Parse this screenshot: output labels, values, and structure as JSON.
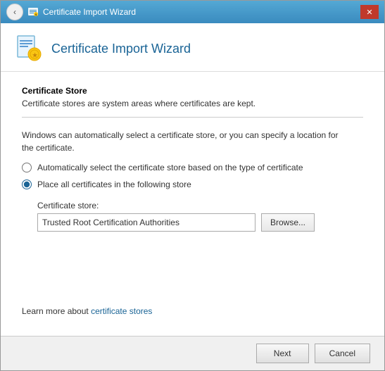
{
  "window": {
    "title": "Certificate Import Wizard",
    "close_label": "✕"
  },
  "header": {
    "title": "Certificate Import Wizard"
  },
  "section": {
    "title": "Certificate Store",
    "description": "Certificate stores are system areas where certificates are kept."
  },
  "info": {
    "text_blue": "Windows can automatically select a certificate store, or you can specify a location for",
    "text_normal": "the certificate."
  },
  "radio_options": {
    "auto_label": "Automatically select the certificate store based on the type of certificate",
    "manual_label": "Place all certificates in the following store"
  },
  "store": {
    "label": "Certificate store:",
    "value": "Trusted Root Certification Authorities",
    "browse_label": "Browse..."
  },
  "learn_more": {
    "prefix": "Learn more about ",
    "link_text": "certificate stores"
  },
  "footer": {
    "next_label": "Next",
    "cancel_label": "Cancel"
  }
}
